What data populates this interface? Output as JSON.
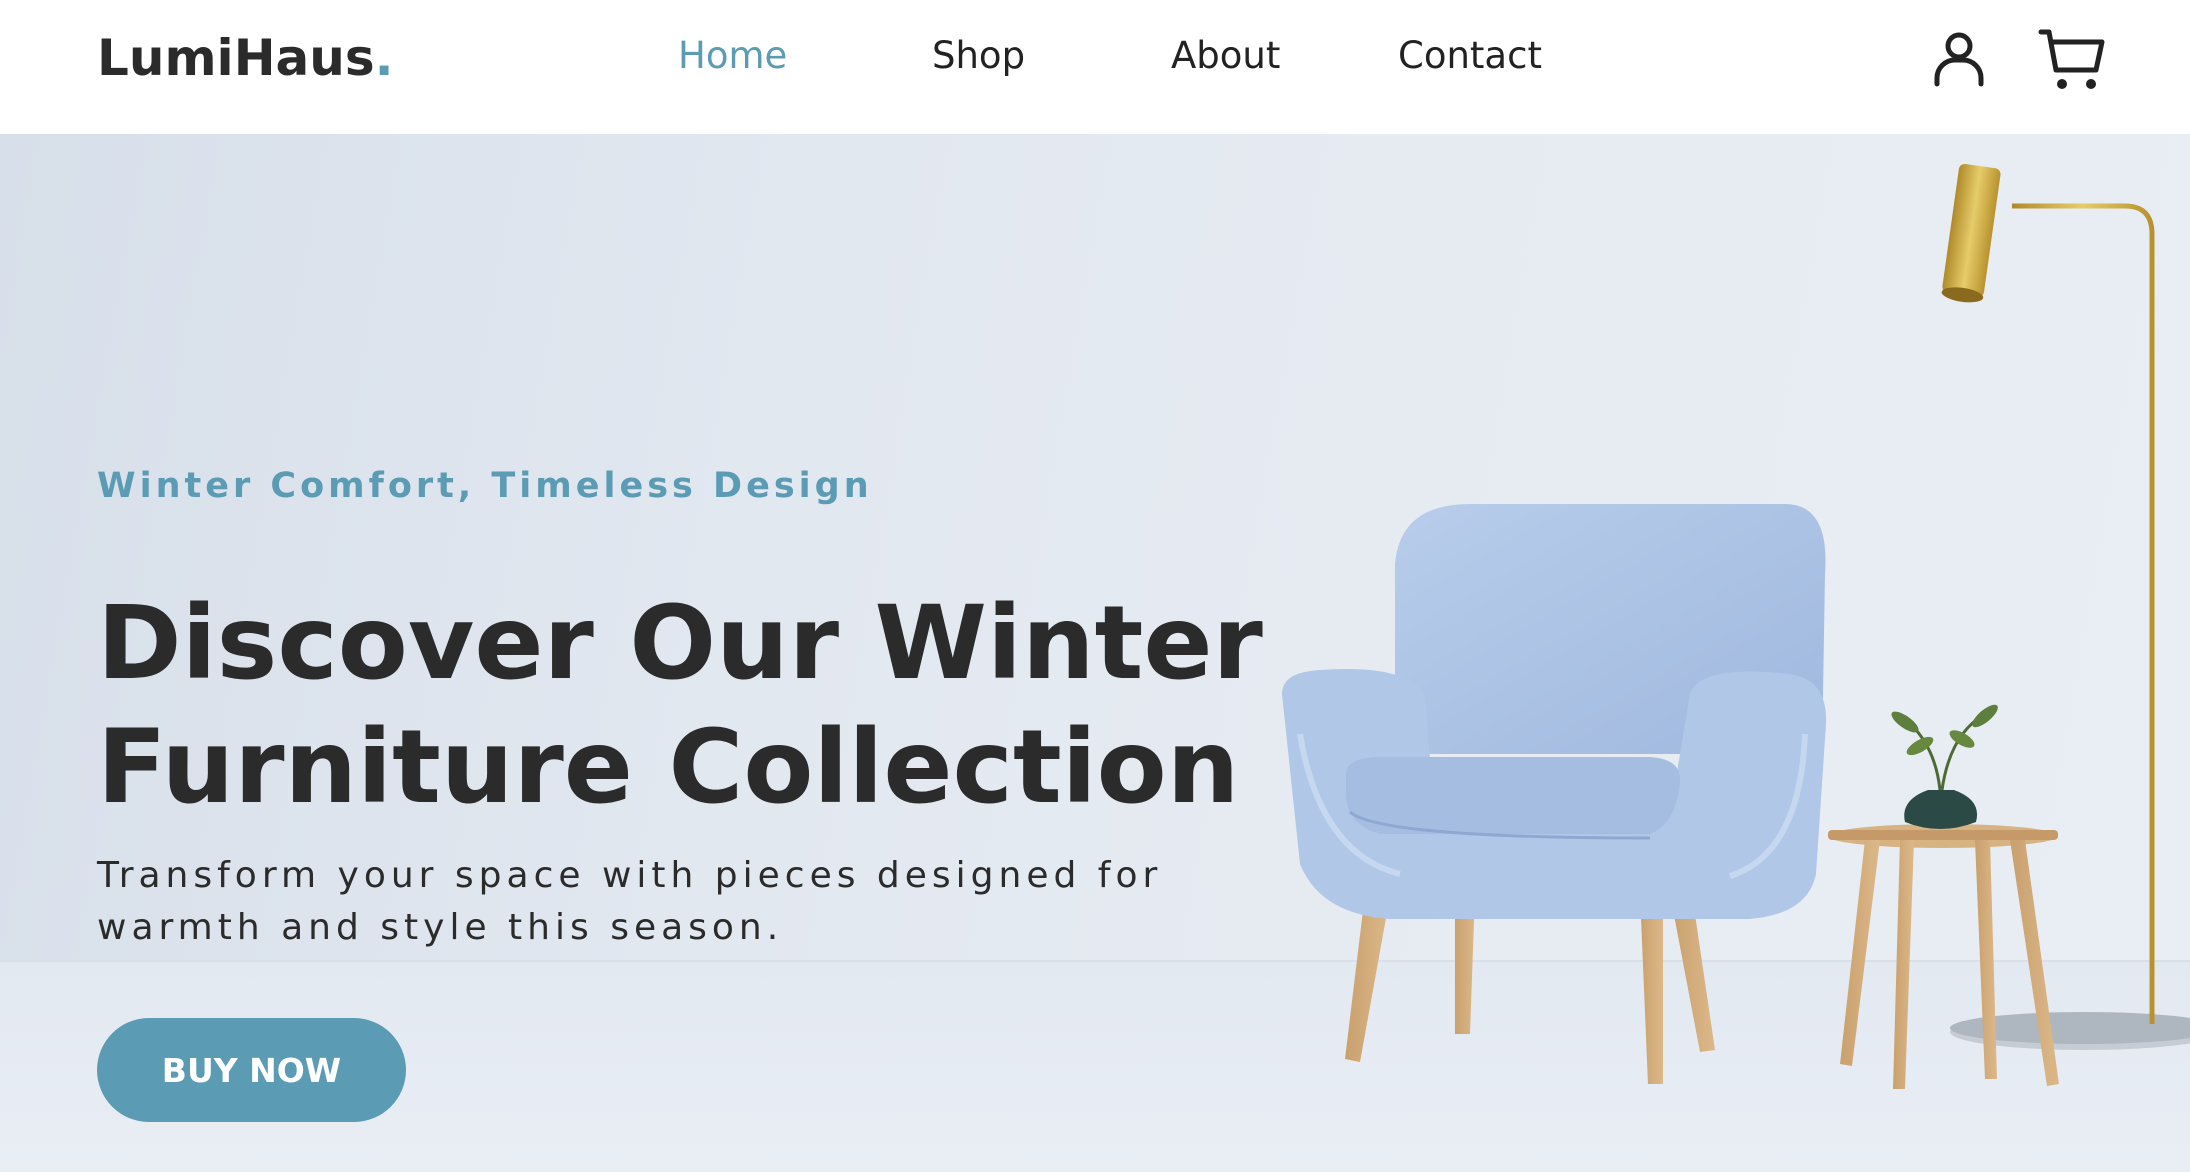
{
  "brand": {
    "name": "LumiHaus",
    "dot": ".",
    "accent_color": "#5b9bb4"
  },
  "nav": {
    "items": [
      {
        "label": "Home",
        "active": true
      },
      {
        "label": "Shop",
        "active": false
      },
      {
        "label": "About",
        "active": false
      },
      {
        "label": "Contact",
        "active": false
      }
    ]
  },
  "header_icons": {
    "account": "user-icon",
    "cart": "cart-icon"
  },
  "hero": {
    "tagline": "Winter Comfort, Timeless Design",
    "headline_line1": "Discover Our Winter",
    "headline_line2": "Furniture Collection",
    "subtext_line1": "Transform your space with pieces designed for",
    "subtext_line2": "warmth and style this season.",
    "cta_label": "BUY NOW",
    "image_items": [
      "armchair",
      "side-table",
      "plant-vase",
      "floor-lamp"
    ]
  },
  "colors": {
    "text_dark": "#2b2b2b",
    "accent": "#5b9bb4",
    "background_hero": "#e4e9f0"
  }
}
